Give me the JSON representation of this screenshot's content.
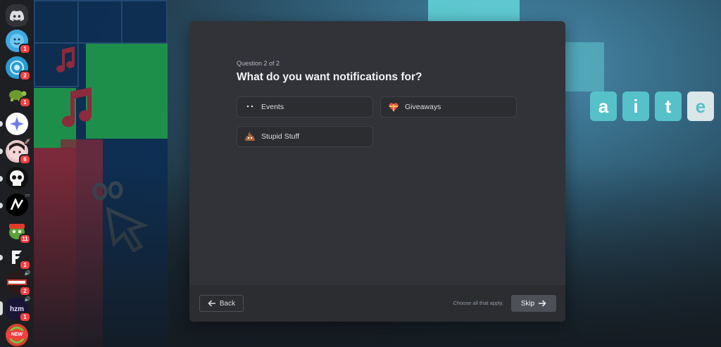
{
  "modal": {
    "question_count": "Question 2 of 2",
    "title": "What do you want notifications for?",
    "options": [
      {
        "label": "Events",
        "icon": "mask-icon"
      },
      {
        "label": "Giveaways",
        "icon": "heart-ribbon-icon"
      },
      {
        "label": "Stupid Stuff",
        "icon": "poop-icon"
      }
    ],
    "back_label": "Back",
    "hint": "Choose all that apply.",
    "skip_label": "Skip"
  },
  "sidebar": {
    "servers": [
      {
        "name": "discord-home",
        "badge": ""
      },
      {
        "name": "server-1",
        "badge": "1"
      },
      {
        "name": "server-2",
        "badge": "2"
      },
      {
        "name": "server-3",
        "badge": "1"
      },
      {
        "name": "server-4",
        "badge": ""
      },
      {
        "name": "server-5",
        "badge": "6"
      },
      {
        "name": "server-6",
        "badge": ""
      },
      {
        "name": "server-7",
        "badge": ""
      },
      {
        "name": "server-8",
        "badge": "11"
      },
      {
        "name": "server-9",
        "badge": "1"
      },
      {
        "name": "server-10",
        "badge": "2"
      },
      {
        "name": "server-11",
        "badge": "1"
      },
      {
        "name": "server-12",
        "badge": ""
      }
    ],
    "server_text": {
      "logo_text": "hzm",
      "new_label": "NEW"
    }
  },
  "colors": {
    "modal_bg": "#313338",
    "footer_bg": "#2b2d31",
    "badge": "#f23f43",
    "skip_bg": "#4e5058"
  }
}
